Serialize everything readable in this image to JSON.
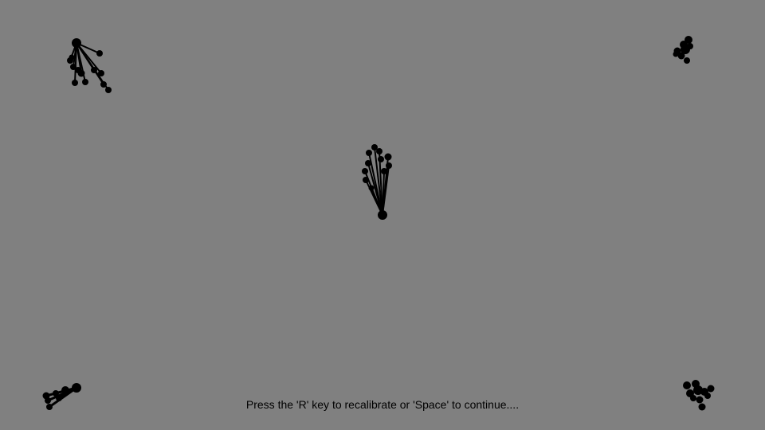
{
  "screen": {
    "background_color": "#808080",
    "marker_color": "#000000"
  },
  "prompt": {
    "text": "Press the 'R' key to recalibrate or 'Space' to continue...."
  },
  "calibration_targets": [
    {
      "name": "top-left",
      "gaze_pattern": "spread"
    },
    {
      "name": "top-right",
      "gaze_pattern": "clustered"
    },
    {
      "name": "center",
      "gaze_pattern": "spread"
    },
    {
      "name": "bottom-left",
      "gaze_pattern": "spread"
    },
    {
      "name": "bottom-right",
      "gaze_pattern": "clustered"
    }
  ]
}
